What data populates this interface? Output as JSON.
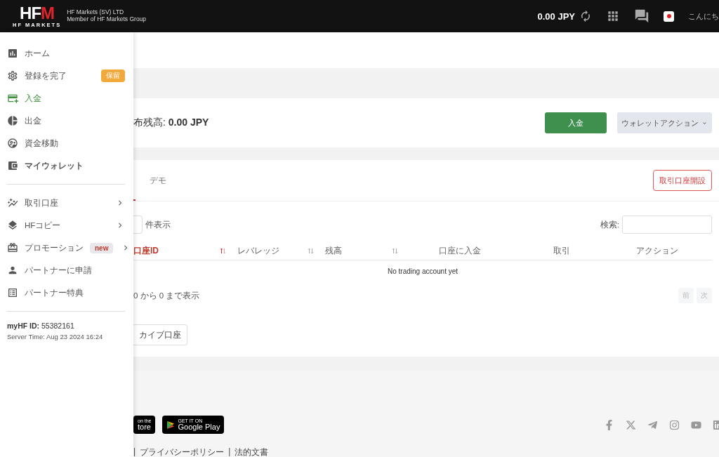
{
  "header": {
    "logo": {
      "mark_main": "HF",
      "mark_accent": "M",
      "sub": "HF MARKETS"
    },
    "company": [
      "HF Markets (SV) LTD",
      "Member of HF Markets Group"
    ],
    "balance": "0.00 JPY",
    "greeting": "こんにち"
  },
  "sidebar": {
    "groups": [
      [
        {
          "label": "ホーム",
          "selected": false
        },
        {
          "label": "登録を完了",
          "selected": false,
          "badge": {
            "text": "保留",
            "kind": "warning"
          }
        },
        {
          "label": "入金",
          "selected": true
        },
        {
          "label": "出金",
          "selected": false
        },
        {
          "label": "資金移動",
          "selected": false
        },
        {
          "label": "マイウォレット",
          "selected": false,
          "bold": true
        }
      ],
      [
        {
          "label": "取引口座",
          "selected": false,
          "expandable": true
        },
        {
          "label": "HFコピー",
          "selected": false,
          "expandable": true
        },
        {
          "label": "プロモーション",
          "selected": false,
          "expandable": true,
          "badge": {
            "text": "new",
            "kind": "new"
          }
        },
        {
          "label": "パートナーに申請",
          "selected": false
        },
        {
          "label": "パートナー特典",
          "selected": false
        }
      ]
    ],
    "id_label": "myHF ID:",
    "id_value": "55382161",
    "server_time": "Server Time: Aug 23 2024 16:24"
  },
  "wallet": {
    "label": "布残高:",
    "value": "0.00 JPY",
    "buttons": [
      {
        "label": "入金",
        "kind": "primary"
      },
      {
        "label": "ウォレットアクション",
        "kind": "dropdown"
      }
    ]
  },
  "accounts": {
    "tabs": [
      {
        "label": "デモ",
        "selected": false
      }
    ],
    "open_button": "取引口座開設",
    "length_label": "件表示",
    "search_label": "検索:",
    "columns": [
      {
        "label": "口座ID",
        "sortable": true,
        "sorted": true
      },
      {
        "label": "レバレッジ",
        "sortable": true,
        "sorted": false
      },
      {
        "label": "残高",
        "sortable": true,
        "sorted": false
      },
      {
        "label": "口座に入金",
        "sortable": false,
        "sorted": false
      },
      {
        "label": "取引",
        "sortable": false,
        "sorted": false
      },
      {
        "label": "アクション",
        "sortable": false,
        "sorted": false
      }
    ],
    "empty": "No trading account yet",
    "info": "0 から 0 まで表示",
    "pager": [
      {
        "label": "前",
        "disabled": true
      },
      {
        "label": "次",
        "disabled": true
      }
    ],
    "archive_button": "カイブ口座"
  },
  "footer": {
    "app_store": [
      "on the",
      "tore"
    ],
    "google_play": [
      "GET IT ON",
      "Google Play"
    ],
    "links": [
      "|",
      "プライバシーポリシー",
      "|",
      "法的文書"
    ]
  }
}
